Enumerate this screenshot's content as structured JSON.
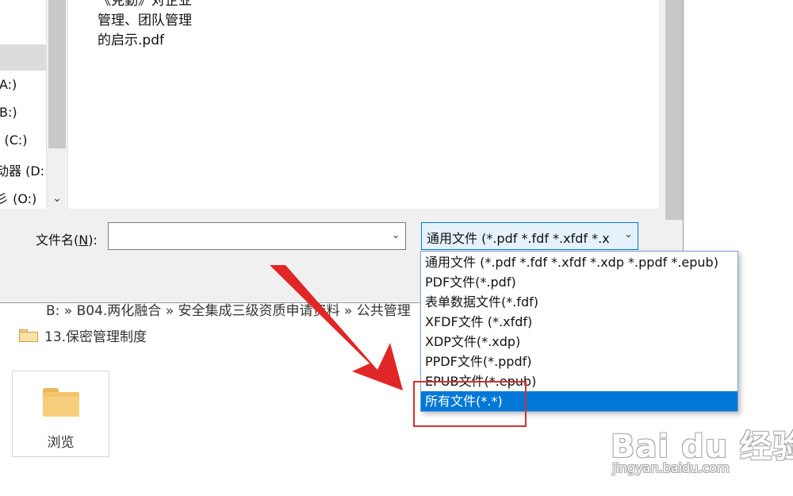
{
  "background": {
    "breadcrumb": "B: » B04.两化融合 » 安全集成三级资质申请资料 » 公共管理",
    "folder_name": "13.保密管理制度",
    "browse_label": "浏览",
    "folder_icon": "folder-icon"
  },
  "dialog": {
    "nav_items": [
      "A:)",
      "B:)",
      "C:)",
      "动器 (D:",
      "彡 (O:)"
    ],
    "nav_labels": [
      ": (C:)",
      "彡 (O:)"
    ],
    "file_item_lines": [
      "《克勤》对企业",
      "管理、团队管理",
      "的启示.pdf"
    ],
    "file_name_label": "文件名(",
    "file_name_key": "N",
    "file_name_suffix": "):",
    "file_name_value": "",
    "file_type_value": "通用文件 (*.pdf *.fdf *.xfdf *.x"
  },
  "dropdown": {
    "options": [
      "通用文件 (*.pdf *.fdf *.xfdf *.xdp *.ppdf *.epub)",
      "PDF文件(*.pdf)",
      "表单数据文件(*.fdf)",
      "XFDF文件 (*.xfdf)",
      "XDP文件(*.xdp)",
      "PPDF文件(*.ppdf)",
      "EPUB文件(*.epub)",
      "所有文件(*.*)"
    ],
    "selected_index": 7
  },
  "annotation": {
    "arrow_color": "#e02626",
    "box_color": "#d83030"
  },
  "watermark": {
    "main": "Bai du 经验",
    "sub": "jingyan.baidu.com"
  },
  "colors": {
    "selection": "#0078d7",
    "dialog_bg": "#f0f0f0"
  }
}
